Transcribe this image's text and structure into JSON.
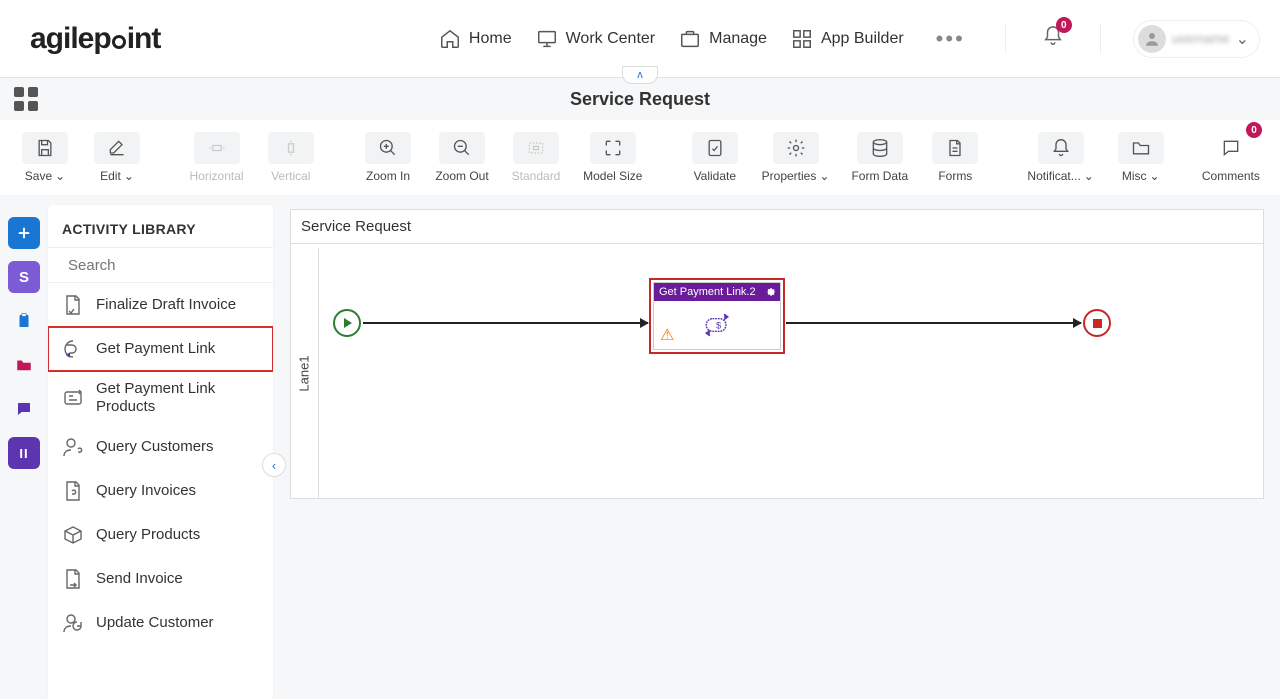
{
  "brand": "agilepoint",
  "nav": {
    "home": "Home",
    "work_center": "Work Center",
    "manage": "Manage",
    "app_builder": "App Builder",
    "notifications_count": "0",
    "user_name": "username"
  },
  "page_title": "Service Request",
  "toolbar": {
    "save": "Save",
    "edit": "Edit",
    "horizontal": "Horizontal",
    "vertical": "Vertical",
    "zoom_in": "Zoom In",
    "zoom_out": "Zoom Out",
    "standard": "Standard",
    "model_size": "Model Size",
    "validate": "Validate",
    "properties": "Properties",
    "form_data": "Form Data",
    "forms": "Forms",
    "notifications": "Notificat...",
    "misc": "Misc",
    "comments": "Comments",
    "comments_count": "0"
  },
  "library": {
    "title": "ACTIVITY LIBRARY",
    "search_placeholder": "Search",
    "items": [
      {
        "label": "Finalize Draft Invoice"
      },
      {
        "label": "Get Payment Link"
      },
      {
        "label": "Get Payment Link Products"
      },
      {
        "label": "Query Customers"
      },
      {
        "label": "Query Invoices"
      },
      {
        "label": "Query Products"
      },
      {
        "label": "Send Invoice"
      },
      {
        "label": "Update Customer"
      }
    ]
  },
  "canvas": {
    "title": "Service Request",
    "lane": "Lane1",
    "activity_label": "Get Payment Link.2"
  }
}
